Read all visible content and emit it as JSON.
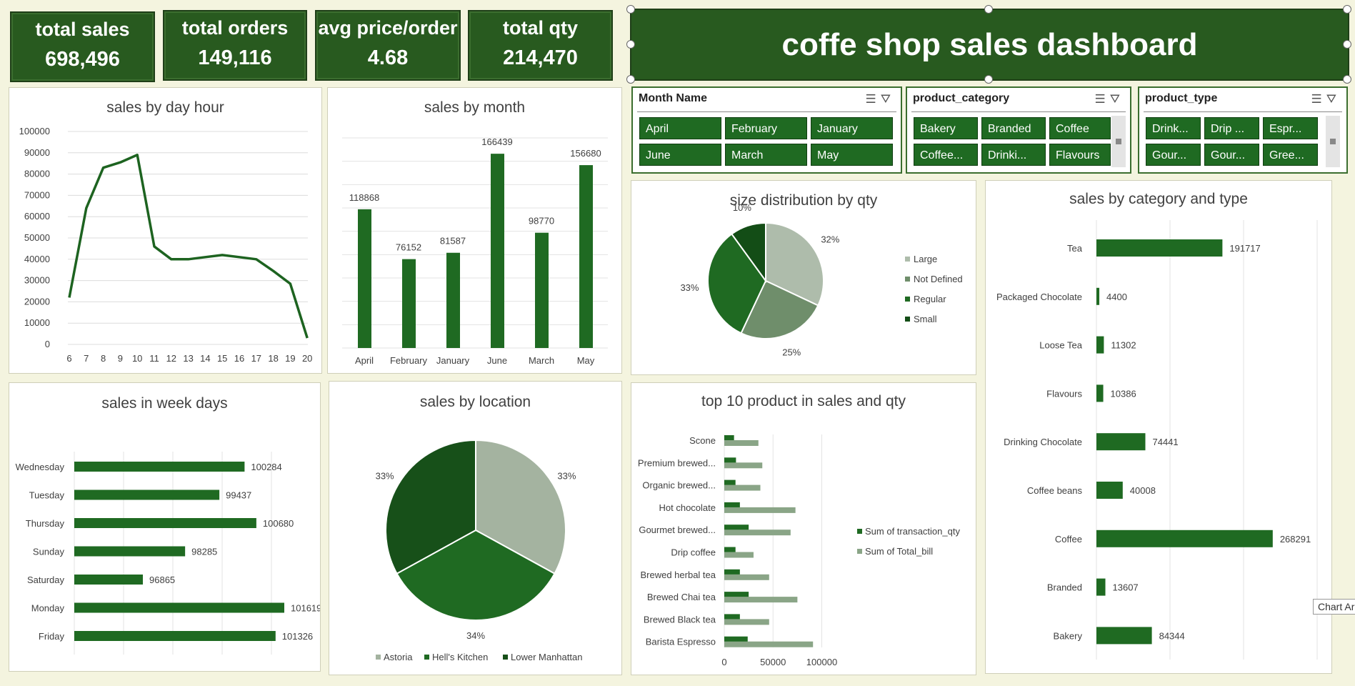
{
  "kpis": [
    {
      "label": "total sales",
      "value": "698,496"
    },
    {
      "label": "total orders",
      "value": "149,116"
    },
    {
      "label": "avg price/order",
      "value": "4.68"
    },
    {
      "label": "total qty",
      "value": "214,470"
    }
  ],
  "dashboard_title": "coffe shop sales dashboard",
  "slicers": {
    "month": {
      "title": "Month Name",
      "items": [
        "April",
        "February",
        "January",
        "June",
        "March",
        "May"
      ]
    },
    "category": {
      "title": "product_category",
      "items": [
        "Bakery",
        "Branded",
        "Coffee",
        "Coffee...",
        "Drinki...",
        "Flavours"
      ]
    },
    "type": {
      "title": "product_type",
      "items": [
        "Drink...",
        "Drip ...",
        "Espr...",
        "Gour...",
        "Gour...",
        "Gree..."
      ]
    }
  },
  "tooltip": "Chart Ar",
  "colors": {
    "dark_green": "#285a1f",
    "bar_green": "#1f6a22",
    "light_gray_green": "#a8b8a6",
    "mid_green": "#6b8f68"
  },
  "chart_data": [
    {
      "type": "line",
      "title": "sales by day hour",
      "x": [
        6,
        7,
        8,
        9,
        10,
        11,
        12,
        13,
        14,
        15,
        16,
        17,
        18,
        19,
        20
      ],
      "values": [
        22000,
        64000,
        83000,
        85500,
        89000,
        46000,
        40000,
        40000,
        41000,
        42000,
        41000,
        40000,
        34500,
        28500,
        3000
      ],
      "ylim": [
        0,
        100000
      ],
      "yticks": [
        0,
        10000,
        20000,
        30000,
        40000,
        50000,
        60000,
        70000,
        80000,
        90000,
        100000
      ],
      "grid": true
    },
    {
      "type": "bar",
      "title": "sales by month",
      "categories": [
        "April",
        "February",
        "January",
        "June",
        "March",
        "May"
      ],
      "values": [
        118868,
        76152,
        81587,
        166439,
        98770,
        156680
      ],
      "ylim": [
        0,
        180000
      ]
    },
    {
      "type": "pie",
      "title": "size distribution by qty",
      "categories": [
        "Large",
        "Not Defined",
        "Regular",
        "Small"
      ],
      "values": [
        32,
        25,
        33,
        10
      ],
      "labels": [
        "32%",
        "25%",
        "33%",
        "10%"
      ],
      "legend": "right"
    },
    {
      "type": "bar",
      "orientation": "horizontal",
      "title": "sales by category and type",
      "categories": [
        "Tea",
        "Packaged Chocolate",
        "Loose Tea",
        "Flavours",
        "Drinking Chocolate",
        "Coffee beans",
        "Coffee",
        "Branded",
        "Bakery"
      ],
      "values": [
        191717,
        4400,
        11302,
        10386,
        74441,
        40008,
        268291,
        13607,
        84344
      ],
      "xlim": [
        0,
        300000
      ]
    },
    {
      "type": "bar",
      "orientation": "horizontal",
      "title": "sales in week days",
      "categories": [
        "Wednesday",
        "Tuesday",
        "Thursday",
        "Sunday",
        "Saturday",
        "Monday",
        "Friday"
      ],
      "values": [
        100284,
        99437,
        100680,
        98285,
        96865,
        101619,
        101326
      ],
      "xlim": [
        90000,
        105000
      ]
    },
    {
      "type": "pie",
      "title": "sales by location",
      "categories": [
        "Astoria",
        "Hell's Kitchen",
        "Lower Manhattan"
      ],
      "values": [
        33,
        34,
        33
      ],
      "labels": [
        "33%",
        "34%",
        "33%"
      ],
      "legend": "bottom"
    },
    {
      "type": "bar",
      "orientation": "horizontal",
      "title": "top 10 product in sales and qty",
      "categories": [
        "Scone",
        "Premium brewed...",
        "Organic brewed...",
        "Hot chocolate",
        "Gourmet brewed...",
        "Drip coffee",
        "Brewed herbal tea",
        "Brewed Chai tea",
        "Brewed Black tea",
        "Barista Espresso"
      ],
      "series": [
        {
          "name": "Sum of transaction_qty",
          "values": [
            10000,
            12000,
            11500,
            16000,
            25000,
            11500,
            16000,
            25000,
            16000,
            24000
          ]
        },
        {
          "name": "Sum of Total_bill",
          "values": [
            35000,
            39000,
            37000,
            73000,
            68000,
            30000,
            46000,
            75000,
            46000,
            91000
          ]
        }
      ],
      "xticks": [
        0,
        50000,
        100000
      ],
      "xlim": [
        0,
        140000
      ],
      "legend": "right"
    }
  ]
}
